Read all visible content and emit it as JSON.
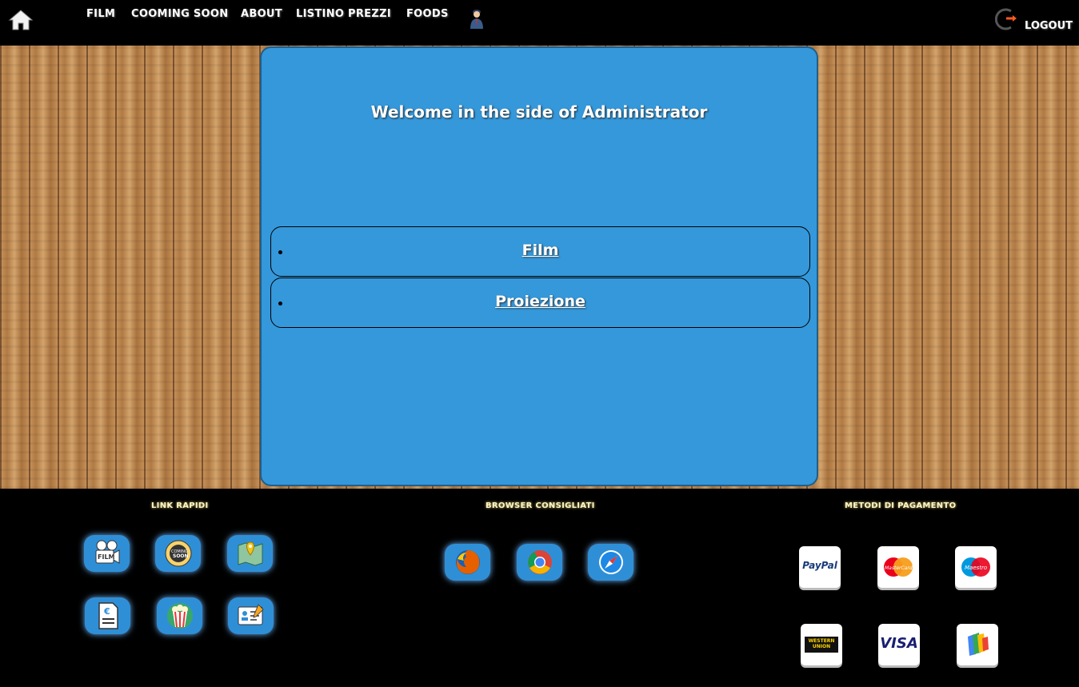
{
  "nav": {
    "home_icon": "home-icon",
    "items": [
      "FILM",
      "COOMING SOON",
      "ABOUT",
      "LISTINO PREZZI",
      "FOODS"
    ],
    "user_icon": "admin-user-icon",
    "logout_label": "LOGOUT",
    "logout_icon": "logout-icon"
  },
  "main": {
    "welcome": "Welcome in the side of Administrator",
    "menu": [
      {
        "label": "Film"
      },
      {
        "label": "Proiezione"
      }
    ]
  },
  "footer": {
    "quick_links": {
      "title": "LINK RAPIDI",
      "icons": [
        "film-camera-icon",
        "coming-soon-icon",
        "map-icon",
        "price-list-icon",
        "popcorn-icon",
        "contact-card-icon"
      ]
    },
    "browsers": {
      "title": "BROWSER CONSIGLIATI",
      "icons": [
        "firefox-icon",
        "chrome-icon",
        "safari-icon"
      ]
    },
    "payments": {
      "title": "METODI DI PAGAMENTO",
      "methods": [
        "PayPal",
        "MasterCard",
        "Maestro",
        "WESTERN UNION",
        "VISA",
        "wallet"
      ]
    }
  },
  "colors": {
    "panel": "#3498db",
    "topbar": "#000000",
    "accent_orange": "#ff5a1f"
  }
}
